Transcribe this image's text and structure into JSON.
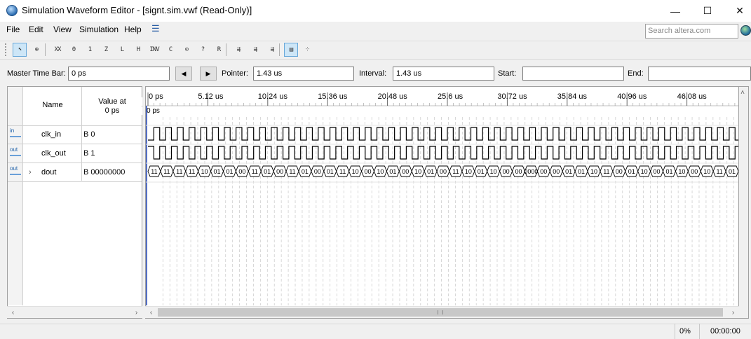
{
  "window": {
    "title": "Simulation Waveform Editor - [signt.sim.vwf (Read-Only)]"
  },
  "window_controls": {
    "minimize": "—",
    "maximize": "☐",
    "close": "✕"
  },
  "menu": [
    "File",
    "Edit",
    "View",
    "Simulation",
    "Help"
  ],
  "search": {
    "placeholder": "Search altera.com"
  },
  "toolbar": {
    "buttons": [
      {
        "icon": "pointer-icon",
        "glyph": "⬉",
        "active": true
      },
      {
        "icon": "zoom-icon",
        "glyph": "⊕",
        "active": false
      },
      {
        "icon": "force-unknown-icon",
        "glyph": "XX",
        "active": false
      },
      {
        "icon": "force-low-icon",
        "glyph": "0",
        "active": false
      },
      {
        "icon": "force-high-icon",
        "glyph": "1",
        "active": false
      },
      {
        "icon": "force-high-z-icon",
        "glyph": "Z",
        "active": false
      },
      {
        "icon": "force-weak-low-icon",
        "glyph": "L",
        "active": false
      },
      {
        "icon": "force-weak-high-icon",
        "glyph": "H",
        "active": false
      },
      {
        "icon": "invert-icon",
        "glyph": "INV",
        "active": false
      },
      {
        "icon": "count-value-icon",
        "glyph": "C",
        "active": false
      },
      {
        "icon": "clock-icon",
        "glyph": "⊙",
        "active": false
      },
      {
        "icon": "arbitrary-value-icon",
        "glyph": "?",
        "active": false
      },
      {
        "icon": "random-value-icon",
        "glyph": "R",
        "active": false
      },
      {
        "icon": "functional-sim-icon",
        "glyph": "⇶",
        "active": false
      },
      {
        "icon": "timing-sim-icon",
        "glyph": "⇶",
        "active": false
      },
      {
        "icon": "netlist-icon",
        "glyph": "⇶",
        "active": false
      },
      {
        "icon": "snap-to-grid-icon",
        "glyph": "▤",
        "active": true
      },
      {
        "icon": "grid-icon",
        "glyph": "⁘",
        "active": false
      }
    ]
  },
  "timebar": {
    "master_label": "Master Time Bar:",
    "master_value": "0 ps",
    "prev": "◀",
    "next": "▶",
    "pointer_label": "Pointer:",
    "pointer_value": "1.43 us",
    "interval_label": "Interval:",
    "interval_value": "1.43 us",
    "start_label": "Start:",
    "start_value": "",
    "end_label": "End:",
    "end_value": ""
  },
  "signal_table": {
    "col_name": "Name",
    "col_value_line1": "Value at",
    "col_value_line2": "0 ps",
    "signals": [
      {
        "type": "in",
        "name": "clk_in",
        "value": "B 0",
        "expandable": false,
        "icon": "input-pin-icon"
      },
      {
        "type": "out",
        "name": "clk_out",
        "value": "B 1",
        "expandable": false,
        "icon": "output-pin-icon"
      },
      {
        "type": "out",
        "name": "dout",
        "value": "B 00000000",
        "expandable": true,
        "icon": "output-bus-icon"
      }
    ]
  },
  "timeline": {
    "tick_labels": [
      "0 ps",
      "5.12 us",
      "10.24 us",
      "15.36 us",
      "20.48 us",
      "25.6 us",
      "30.72 us",
      "35.84 us",
      "40.96 us",
      "46.08 us"
    ],
    "cursor_label": "0 ps",
    "dout_segments": [
      "11",
      "11",
      "11",
      "11",
      "10",
      "01",
      "01",
      "00",
      "11",
      "01",
      "00",
      "11",
      "01",
      "00",
      "01",
      "11",
      "10",
      "00",
      "10",
      "01",
      "00",
      "10",
      "01",
      "00",
      "11",
      "10",
      "01",
      "10",
      "00",
      "00",
      "0000",
      "00",
      "00",
      "01",
      "01",
      "10",
      "11",
      "00",
      "01",
      "10",
      "00",
      "01",
      "10",
      "00",
      "10",
      "11",
      "01"
    ]
  },
  "status": {
    "progress": "0%",
    "elapsed": "00:00:00"
  }
}
